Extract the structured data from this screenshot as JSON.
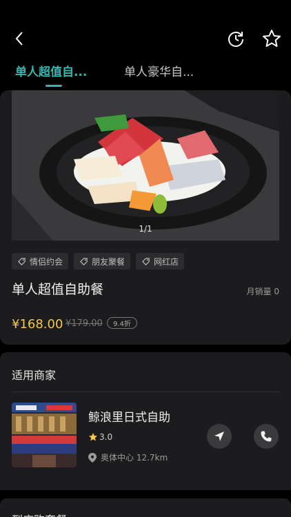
{
  "tabs": [
    {
      "label": "单人超值自...",
      "active": true
    },
    {
      "label": "单人豪华自...",
      "active": false
    }
  ],
  "icons": {
    "back": "chevron-left-icon",
    "refresh": "refresh-icon",
    "favorite": "star-outline-icon"
  },
  "colors": {
    "accent": "#36b6b0",
    "price": "#f2c94c",
    "card_bg": "#1c1c1e",
    "page_bg": "#000000"
  },
  "product": {
    "photo_counter": "1/1",
    "tags": [
      "情侣约会",
      "朋友聚餐",
      "网红店"
    ],
    "title": "单人超值自助餐",
    "monthly_sales": "月销量 0",
    "price": "¥168.00",
    "original_price": "¥179.00",
    "discount": "9.4折"
  },
  "merchants": {
    "title": "适用商家",
    "items": [
      {
        "name": "鲸浪里日式自助",
        "rating": "3.0",
        "location": "奥体中心 12.7km"
      }
    ]
  },
  "next_section": {
    "title": "到店购套餐"
  }
}
